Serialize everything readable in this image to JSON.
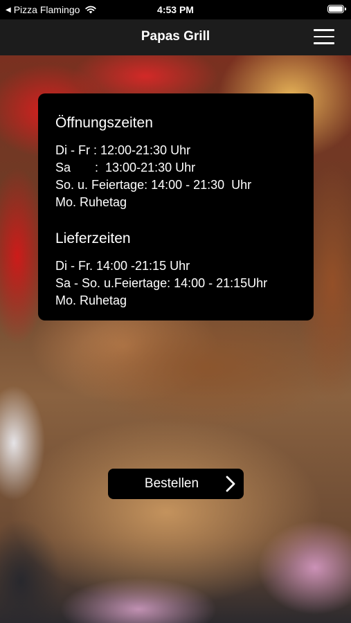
{
  "status_bar": {
    "back_app": "Pizza Flamingo",
    "time": "4:53 PM"
  },
  "nav": {
    "title": "Papas Grill"
  },
  "opening_hours": {
    "title": "Öffnungszeiten",
    "lines": [
      "Di - Fr : 12:00-21:30 Uhr",
      "Sa       :  13:00-21:30 Uhr",
      "So. u. Feiertage: 14:00 - 21:30  Uhr",
      "Mo. Ruhetag"
    ]
  },
  "delivery_hours": {
    "title": "Lieferzeiten",
    "lines": [
      "Di - Fr. 14:00 -21:15 Uhr",
      "Sa - So. u.Feiertage: 14:00 - 21:15Uhr",
      "Mo. Ruhetag"
    ]
  },
  "order_button": {
    "label": "Bestellen"
  }
}
